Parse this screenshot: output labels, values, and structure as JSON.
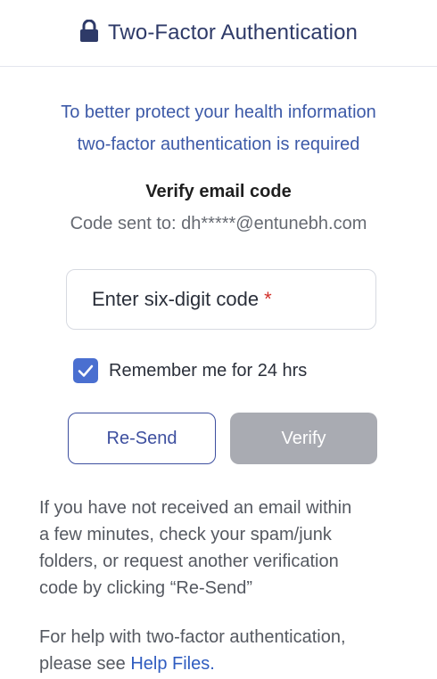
{
  "header": {
    "title": "Two-Factor Authentication",
    "icon": "lock-icon"
  },
  "intro": {
    "line1": "To better protect your health information",
    "line2": "two-factor authentication is required"
  },
  "verify": {
    "title": "Verify email code",
    "sent_prefix": "Code sent to:",
    "email": "dh*****@entunebh.com"
  },
  "code_input": {
    "placeholder": "Enter six-digit code",
    "required_marker": "*"
  },
  "remember": {
    "label": "Remember me for 24 hrs",
    "checked": true
  },
  "buttons": {
    "resend_label": "Re-Send",
    "verify_label": "Verify"
  },
  "help_text": {
    "note_line1": "If you have not received an email within",
    "note_line2": "a few minutes, check your spam/junk",
    "note_line3": "folders, or request another verification",
    "note_line4": "code by clicking “Re-Send”",
    "help_line1": "For help with two-factor authentication,",
    "help_line2_prefix": "please see",
    "help_link": "Help Files."
  },
  "colors": {
    "title": "#2e3a68",
    "accent_blue": "#3d5aa8",
    "checkbox": "#4a6fd0",
    "disabled_button": "#a9abb2",
    "link": "#2f5cc0",
    "required": "#d2312b"
  }
}
